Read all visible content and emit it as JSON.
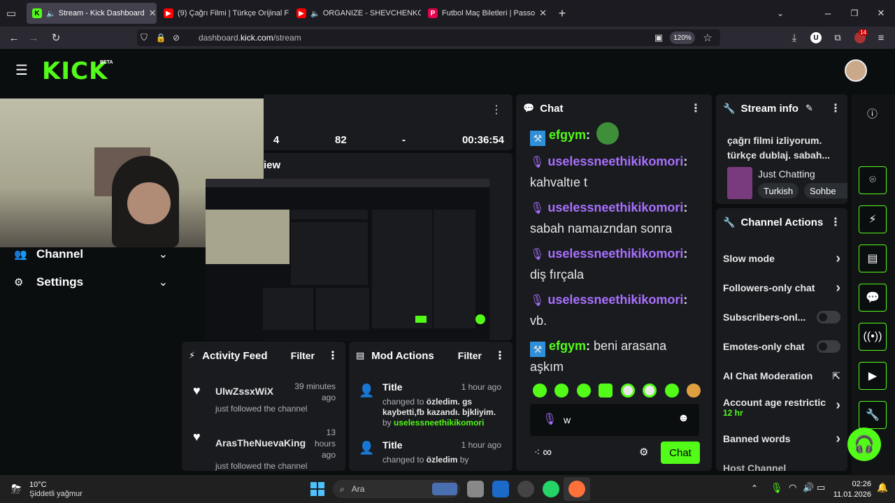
{
  "browser": {
    "tabs": [
      {
        "label": "Stream - Kick Dashboard",
        "favicon": "kick-icon",
        "color": "#53fc18"
      },
      {
        "label": "(9) Çağrı Filmi | Türkçe Orijinal F",
        "favicon": "youtube-icon",
        "color": "#ff0000"
      },
      {
        "label": "ORGANIZE - SHEVCHENKO",
        "favicon": "youtube-icon",
        "color": "#ff0000"
      },
      {
        "label": "Futbol Maç Biletleri | Passo",
        "favicon": "passo-icon",
        "color": "#e4004b"
      }
    ],
    "url_prefix": "dashboard.",
    "url_domain": "kick.com",
    "url_path": "/stream",
    "zoom": "120%",
    "notif_count": "14"
  },
  "kick": {
    "logo": "KICK",
    "beta": "BETA"
  },
  "sidebar": {
    "items": [
      {
        "label": "Channel"
      },
      {
        "label": "Settings"
      }
    ]
  },
  "stats": {
    "v1": "4",
    "v2": "82",
    "v3": "-",
    "duration": "00:36:54"
  },
  "preview": {
    "title_fragment": "iew"
  },
  "chat": {
    "title": "Chat",
    "messages": [
      {
        "user": "efgym",
        "badge": "hammer",
        "text": "",
        "emote": true
      },
      {
        "user": "uselessneethikikomori",
        "badge": "mic",
        "text": "kahvaltıe t"
      },
      {
        "user": "uselessneethikikomori",
        "badge": "mic",
        "text": "sabah namaızndan sonra"
      },
      {
        "user": "uselessneethikikomori",
        "badge": "mic",
        "text": "diş fırçala"
      },
      {
        "user": "uselessneethikikomori",
        "badge": "mic",
        "text": "vb."
      },
      {
        "user": "efgym",
        "badge": "hammer",
        "text": "beni arasana aşkım"
      }
    ],
    "input_value": "w",
    "send_label": "Chat",
    "footer_icon": "infinity-icon"
  },
  "stream_info": {
    "title": "Stream info",
    "description": "çağrı filmi izliyorum. türkçe dublaj. sabah...",
    "category": "Just Chatting",
    "tags": [
      "Turkish",
      "Sohbe"
    ]
  },
  "channel_actions": {
    "title": "Channel Actions",
    "items": [
      {
        "label": "Slow mode",
        "type": "chevron"
      },
      {
        "label": "Followers-only chat",
        "type": "chevron"
      },
      {
        "label": "Subscribers-onl...",
        "type": "toggle"
      },
      {
        "label": "Emotes-only chat",
        "type": "toggle"
      },
      {
        "label": "AI Chat Moderation",
        "type": "external"
      },
      {
        "label": "Account age restrictic",
        "type": "chevron",
        "sub": "12 hr"
      },
      {
        "label": "Banned words",
        "type": "chevron"
      },
      {
        "label": "Host Channel",
        "type": "none"
      }
    ]
  },
  "activity": {
    "title": "Activity Feed",
    "filter": "Filter",
    "items": [
      {
        "user": "UlwZssxWiX",
        "text": "just followed the channel",
        "time": "39 minutes ago"
      },
      {
        "user": "ArasTheNuevaKing",
        "text": "just followed the channel",
        "time": "13 hours ago"
      }
    ]
  },
  "mod_actions": {
    "title": "Mod Actions",
    "filter": "Filter",
    "items": [
      {
        "title": "Title",
        "time": "1 hour ago",
        "prefix": "changed to",
        "value": "özledim. gs kaybetti,fb kazandı. bjkliyim.",
        "by": "by",
        "user": "uselessneethikikomori"
      },
      {
        "title": "Title",
        "time": "1 hour ago",
        "prefix": "changed to",
        "value": "özledim",
        "by": "by",
        "user": ""
      }
    ]
  },
  "taskbar": {
    "weather_temp": "10°C",
    "weather_desc": "Şiddetli yağmur",
    "search_placeholder": "Ara",
    "time": "02:26",
    "date": "11.01.2026"
  }
}
